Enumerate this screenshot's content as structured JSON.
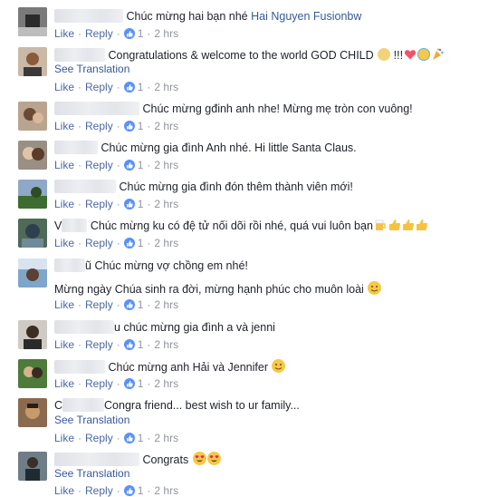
{
  "comments": [
    {
      "text": "Chúc mừng hai bạn nhé",
      "tag": "Hai Nguyen Fusionbw",
      "like": "Like",
      "reply": "Reply",
      "count": "1",
      "time": "2 hrs"
    },
    {
      "text": "Congratulations & welcome to the world GOD CHILD",
      "suffix": "!!!",
      "see_translation": "See Translation",
      "like": "Like",
      "reply": "Reply",
      "count": "1",
      "time": "2 hrs"
    },
    {
      "text": "Chúc mừng gđinh anh nhe! Mừng mẹ tròn con vuông!",
      "like": "Like",
      "reply": "Reply",
      "count": "1",
      "time": "2 hrs"
    },
    {
      "text": "Chúc mừng gia đình Anh nhé. Hi little Santa Claus.",
      "like": "Like",
      "reply": "Reply",
      "count": "1",
      "time": "2 hrs"
    },
    {
      "text": "Chúc mừng gia đình đón thêm thành viên mới!",
      "like": "Like",
      "reply": "Reply",
      "count": "1",
      "time": "2 hrs"
    },
    {
      "name_fragment": "V",
      "text": "Chúc mừng ku có đệ tử nối dõi rồi nhé, quá vui luôn bạn",
      "like": "Like",
      "reply": "Reply",
      "count": "1",
      "time": "2 hrs"
    },
    {
      "name_fragment": "ũ",
      "text": "Chúc mừng vợ chồng em nhé!",
      "second_line": "Mừng ngày Chúa sinh ra đời, mừng hạnh phúc cho muôn loài",
      "like": "Like",
      "reply": "Reply",
      "count": "1",
      "time": "2 hrs"
    },
    {
      "name_fragment": "u",
      "text": "chúc mừng gia đình a và jenni",
      "like": "Like",
      "reply": "Reply",
      "count": "1",
      "time": "2 hrs"
    },
    {
      "text": "Chúc mừng anh Hải và Jennifer",
      "like": "Like",
      "reply": "Reply",
      "count": "1",
      "time": "2 hrs"
    },
    {
      "name_fragment": "C",
      "text": "Congra friend... best wish to ur family...",
      "see_translation": "See Translation",
      "like": "Like",
      "reply": "Reply",
      "count": "1",
      "time": "2 hrs"
    },
    {
      "text": "Congrats",
      "see_translation": "See Translation",
      "like": "Like",
      "reply": "Reply",
      "count": "1",
      "time": "2 hrs"
    }
  ],
  "colors": {
    "link": "#365899",
    "meta": "#90949c",
    "like_badge": "#5890ff"
  }
}
